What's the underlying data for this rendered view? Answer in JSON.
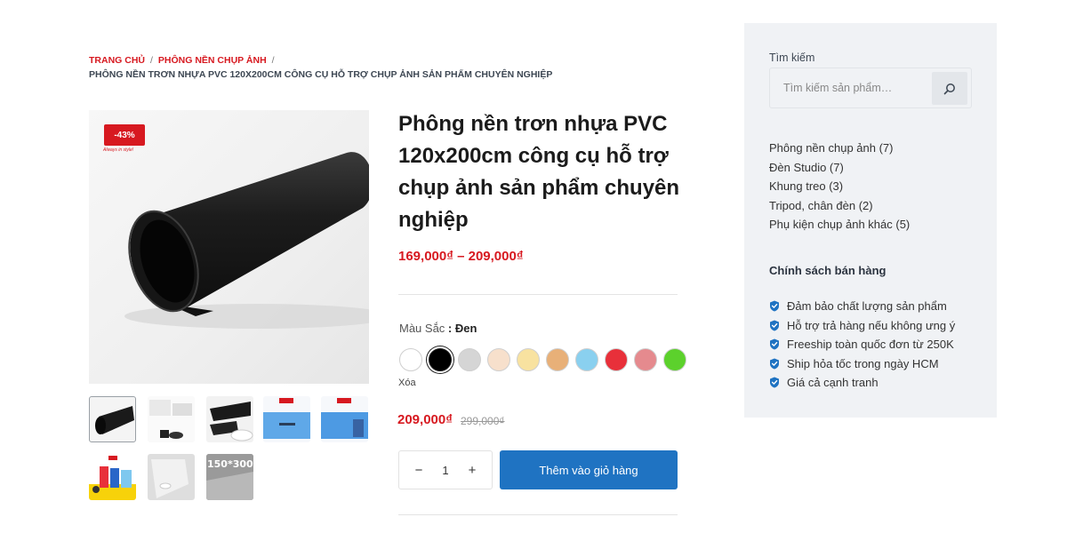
{
  "breadcrumb": {
    "home": "TRANG CHỦ",
    "sep1": "/",
    "category": "PHÔNG NỀN CHỤP ẢNH",
    "sep2": "/",
    "current": "PHÔNG NỀN TRƠN NHỰA PVC 120X200CM CÔNG CỤ HỖ TRỢ CHỤP ẢNH SẢN PHẨM CHUYÊN NGHIỆP"
  },
  "gallery": {
    "badge": "-43%",
    "badge_subtext": "Always in style!",
    "thumbnail_texts": [
      "150*300"
    ],
    "main_icon": "black-pvc-roll-image",
    "thumbnails": [
      "black-roll-thumb",
      "white-studio-thumb",
      "black-white-rolls-thumb",
      "blue-pvc-thumb",
      "blue-pvc-water-thumb",
      "color-rolls-thumb",
      "white-curved-thumb",
      "gray-size-thumb"
    ]
  },
  "product": {
    "title": "Phông nền trơn nhựa PVC 120x200cm công cụ hỗ trợ chụp ảnh sản phẩm chuyên nghiệp",
    "price_range": "169,000₫ – 209,000₫",
    "color_label": "Màu Sắc",
    "color_sep": " : ",
    "color_value": "Đen",
    "swatches": [
      "#ffffff",
      "#000000",
      "#d5d5d5",
      "#f7e0cc",
      "#f8e2a0",
      "#e8b078",
      "#8ad0ef",
      "#e8303a",
      "#e58a8e",
      "#5cd12c"
    ],
    "selected_swatch": 1,
    "clear_label": "Xóa",
    "sale_price": "209,000₫",
    "old_price": "299,000₫",
    "quantity": "1",
    "qty_minus": "−",
    "qty_plus": "+",
    "add_to_cart": "Thêm vào giỏ hàng"
  },
  "sidebar": {
    "search_label": "Tìm kiếm",
    "search_placeholder": "Tìm kiếm sản phẩm…",
    "categories": [
      "Phông nền chụp ảnh (7)",
      "Đèn Studio (7)",
      "Khung treo (3)",
      "Tripod, chân đèn (2)",
      "Phụ kiện chụp ảnh khác (5)"
    ],
    "policy_title": "Chính sách bán hàng",
    "policies": [
      "Đảm bảo chất lượng sản phẩm",
      "Hỗ trợ trả hàng nếu không ưng ý",
      "Freeship toàn quốc đơn từ 250K",
      "Ship hỏa tốc trong ngày HCM",
      "Giá cả cạnh tranh"
    ],
    "policy_icon": "shield-check-icon",
    "policy_icon_color": "#1f73c2"
  },
  "colors": {
    "accent_red": "#d71920",
    "button_blue": "#1f73c2"
  }
}
